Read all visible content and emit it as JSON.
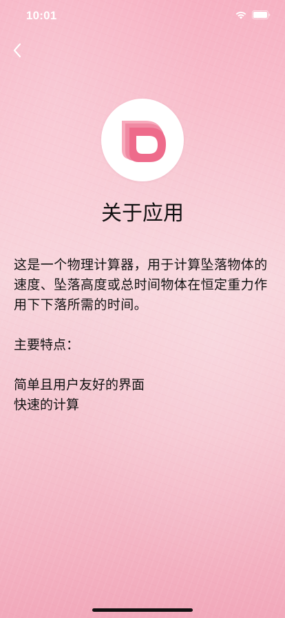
{
  "status_bar": {
    "time": "10:01"
  },
  "nav": {
    "back_icon": "chevron-left-icon"
  },
  "app": {
    "logo_icon": "leaf-logo-icon",
    "accent_color": "#ee6b8b"
  },
  "page": {
    "title": "关于应用",
    "description": "这是一个物理计算器，用于计算坠落物体的速度、坠落高度或总时间物体在恒定重力作用下下落所需的时间。",
    "features_heading": "主要特点：",
    "features": [
      "简单且用户友好的界面",
      "快速的计算"
    ]
  }
}
